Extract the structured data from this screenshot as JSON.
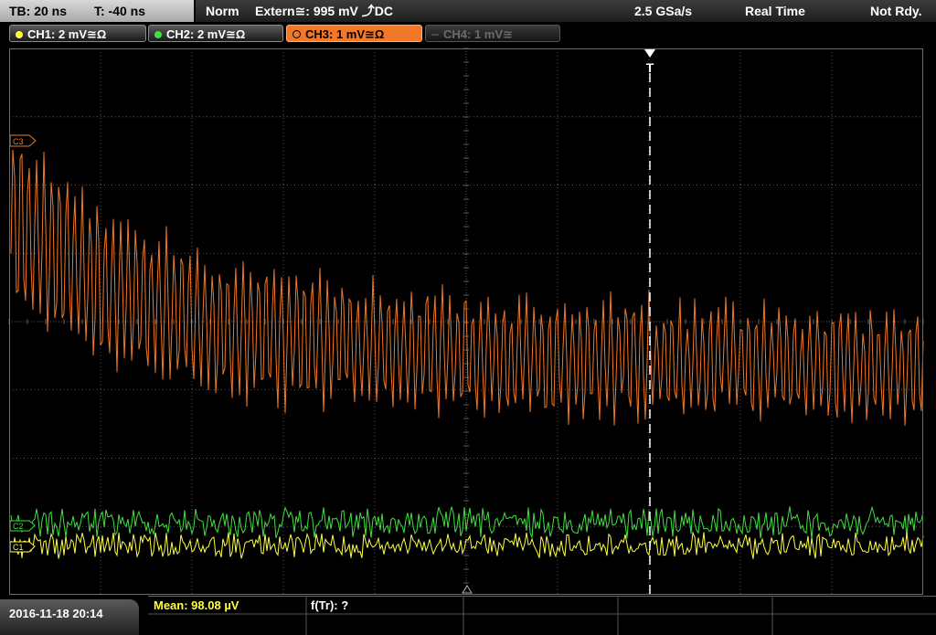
{
  "status_bar": {
    "timebase": "TB: 20 ns",
    "trigger_time": "T: -40 ns",
    "trigger_mode": "Norm",
    "trigger_source": "Extern≅: 995 mV ⤴DC",
    "sample_rate": "2.5 GSa/s",
    "acq_mode": "Real Time",
    "status": "Not Rdy."
  },
  "channels": [
    {
      "label": "CH1: 2 mV≅Ω",
      "color": "#ffff40",
      "state": "on"
    },
    {
      "label": "CH2: 2 mV≅Ω",
      "color": "#40e040",
      "state": "on"
    },
    {
      "label": "CH3: 1 mV≅Ω",
      "color": "#f07828",
      "state": "selected"
    },
    {
      "label": "CH4: 1 mV≅",
      "color": "#6b6b6b",
      "state": "off"
    }
  ],
  "markers": {
    "trigger": "T",
    "ch3": "C3",
    "ch2": "C2",
    "ch1": "C1"
  },
  "bottom": {
    "datetime": "2016-11-18 20:14",
    "mean": "Mean: 98.08 µV",
    "freq": "f(Tr): ?"
  },
  "colors": {
    "ch1": "#ffff40",
    "ch2": "#40e040",
    "ch3": "#f07828",
    "grid": "#5a5a5a"
  }
}
